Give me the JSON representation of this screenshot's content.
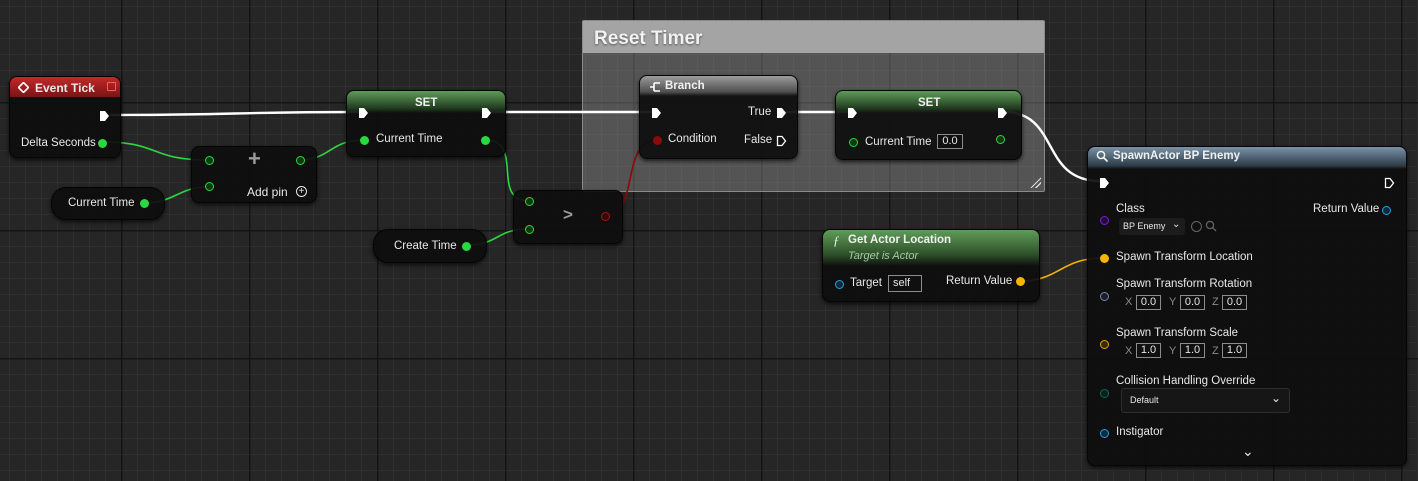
{
  "colors": {
    "exec": "#ffffff",
    "float": "#2ad93f",
    "bool": "#8c0a0a",
    "transform": "#f5b400",
    "object": "#2a9fe0",
    "class": "#7a1fd3",
    "enum": "#0d6b58"
  },
  "comment": {
    "title": "Reset Timer"
  },
  "event_tick": {
    "title": "Event Tick",
    "delta_seconds": "Delta Seconds",
    "icon": "event-diamond-icon"
  },
  "current_time_get": {
    "label": "Current Time"
  },
  "add_node": {
    "symbol": "+",
    "add_pin_label": "Add pin",
    "icon": "add-circle-icon"
  },
  "set1": {
    "title": "SET",
    "pin_label": "Current Time"
  },
  "create_time_get": {
    "label": "Create Time"
  },
  "compare": {
    "symbol": ">"
  },
  "branch": {
    "title": "Branch",
    "condition": "Condition",
    "true_label": "True",
    "false_label": "False",
    "icon": "branch-icon"
  },
  "set2": {
    "title": "SET",
    "pin_label": "Current Time",
    "value": "0.0"
  },
  "get_actor_location": {
    "title": "Get Actor Location",
    "subtitle": "Target is Actor",
    "target_label": "Target",
    "target_value": "self",
    "return_label": "Return Value",
    "icon": "function-icon"
  },
  "spawn": {
    "title": "SpawnActor BP Enemy",
    "icon": "spawn-icon",
    "class_label": "Class",
    "class_value": "BP Enemy",
    "return_label": "Return Value",
    "location_label": "Spawn Transform Location",
    "rotation_label": "Spawn Transform Rotation",
    "rotation": {
      "x": "0.0",
      "y": "0.0",
      "z": "0.0"
    },
    "scale_label": "Spawn Transform Scale",
    "scale": {
      "x": "1.0",
      "y": "1.0",
      "z": "1.0"
    },
    "axis": {
      "x": "X",
      "y": "Y",
      "z": "Z"
    },
    "collision_label": "Collision Handling Override",
    "collision_value": "Default",
    "instigator_label": "Instigator"
  }
}
